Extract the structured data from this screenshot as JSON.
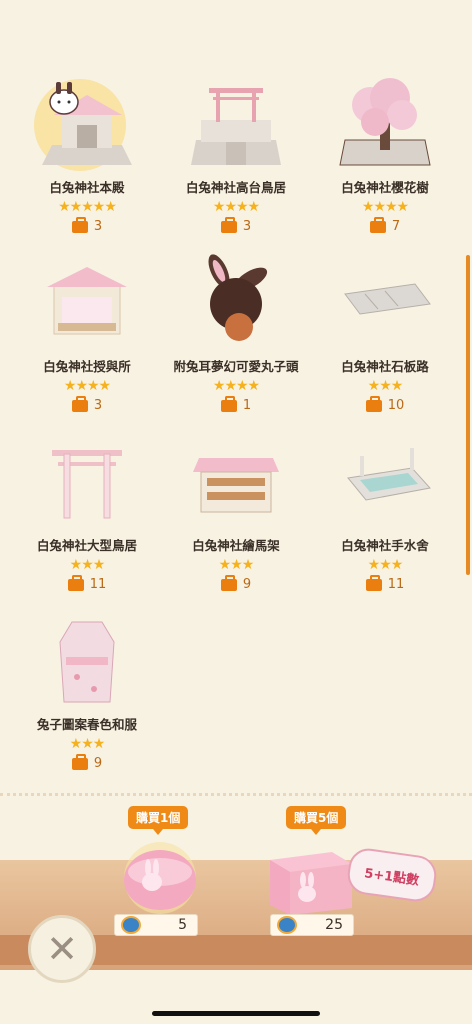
{
  "items": [
    {
      "name": "白兔神社本殿",
      "stars": "★★★★★",
      "count": "3"
    },
    {
      "name": "白兔神社高台鳥居",
      "stars": "★★★★",
      "count": "3"
    },
    {
      "name": "白兔神社櫻花樹",
      "stars": "★★★★",
      "count": "7"
    },
    {
      "name": "白兔神社授與所",
      "stars": "★★★★",
      "count": "3"
    },
    {
      "name": "附兔耳夢幻可愛丸子頭",
      "stars": "★★★★",
      "count": "1"
    },
    {
      "name": "白兔神社石板路",
      "stars": "★★★",
      "count": "10"
    },
    {
      "name": "白兔神社大型鳥居",
      "stars": "★★★",
      "count": "11"
    },
    {
      "name": "白兔神社繪馬架",
      "stars": "★★★",
      "count": "9"
    },
    {
      "name": "白兔神社手水舍",
      "stars": "★★★",
      "count": "11"
    },
    {
      "name": "兔子圖案春色和服",
      "stars": "★★★",
      "count": "9"
    }
  ],
  "shop": {
    "buy_one_label": "購買1個",
    "buy_one_price": "5",
    "buy_five_label": "購買5個",
    "buy_five_price": "25",
    "bonus_label": "5+1點數"
  },
  "colors": {
    "accent": "#ee8a15",
    "star": "#f5b21e",
    "background": "#f8f2e3"
  }
}
